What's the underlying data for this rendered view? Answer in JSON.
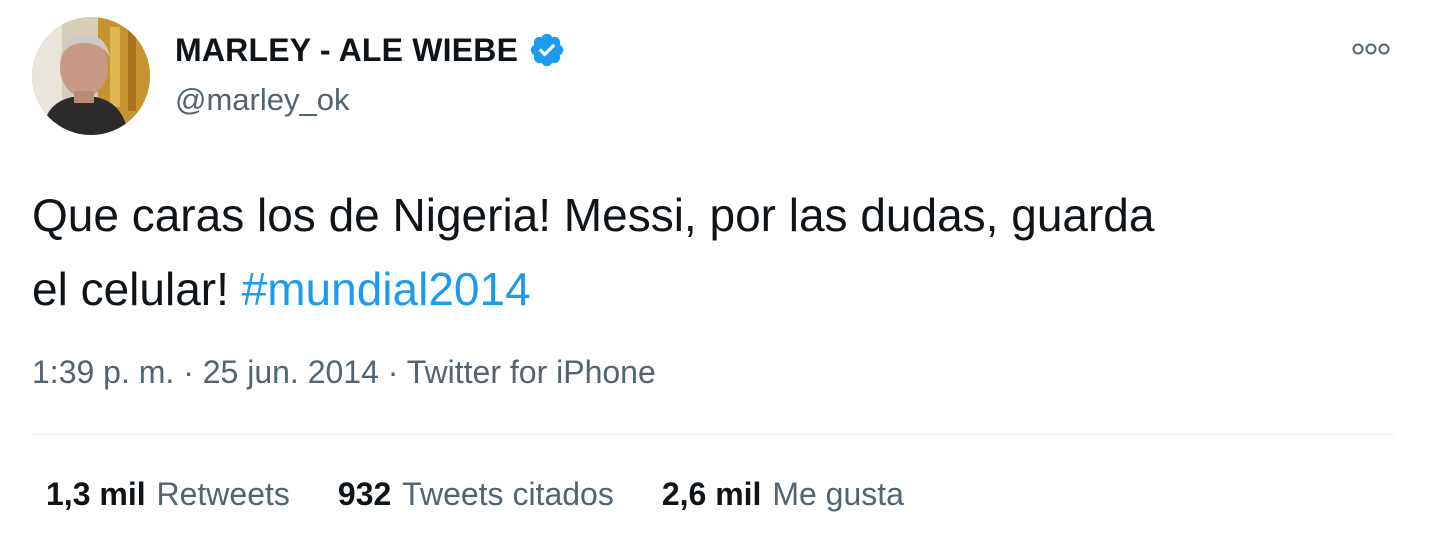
{
  "author": {
    "display_name": "MARLEY - ALE WIEBE",
    "handle": "@marley_ok",
    "verified": true,
    "verified_icon": "verified-badge-icon"
  },
  "tweet": {
    "line1": "Que caras los de Nigeria! Messi, por las dudas, guarda",
    "line2_text": "el celular! ",
    "hashtag": "#mundial2014"
  },
  "meta": {
    "time": "1:39 p. m.",
    "sep1": " · ",
    "date": "25 jun. 2014",
    "sep2": " · ",
    "source": "Twitter for iPhone"
  },
  "stats": [
    {
      "count": "1,3 mil",
      "label": "Retweets"
    },
    {
      "count": "932",
      "label": "Tweets citados"
    },
    {
      "count": "2,6 mil",
      "label": "Me gusta"
    }
  ],
  "colors": {
    "accent": "#1d9bf0",
    "text": "#0f1419",
    "secondary": "#536471",
    "divider": "#e6ecf0"
  }
}
